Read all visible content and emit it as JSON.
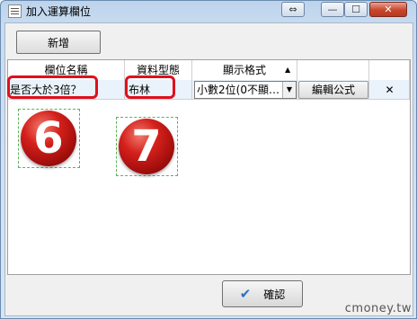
{
  "window": {
    "title": "加入運算欄位",
    "icon": "form-icon",
    "controls": {
      "restore_label": "⇔",
      "minimize_label": "—",
      "maximize_label": "☐",
      "close_label": "✕"
    }
  },
  "toolbar": {
    "add_label": "新增"
  },
  "grid": {
    "columns": [
      "欄位名稱",
      "資料型態",
      "顯示格式",
      "",
      ""
    ],
    "sort_indicator": "▲",
    "rows": [
      {
        "field_name": "是否大於3倍？",
        "data_type": "布林",
        "display_format": "小數2位(0不顯…",
        "edit_formula_label": "編輯公式",
        "delete_label": "✕"
      }
    ]
  },
  "annotations": {
    "marker_6": "6",
    "marker_7": "7",
    "highlight_color": "#e0101c"
  },
  "footer": {
    "ok_label": "確認"
  },
  "watermark": "cmoney.tw"
}
